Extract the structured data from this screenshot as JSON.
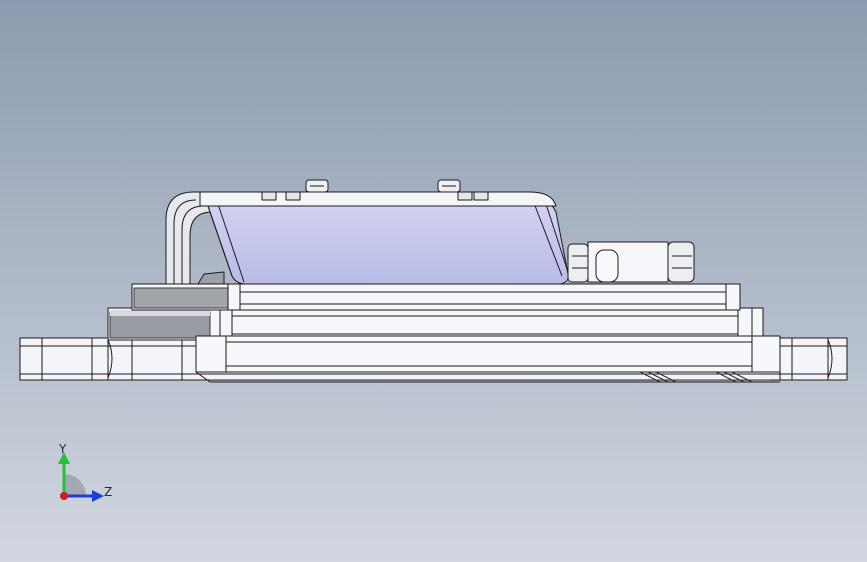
{
  "viewport": {
    "background_top": "#8c9bb0",
    "background_bottom": "#d2d7e0"
  },
  "model": {
    "outline_color": "#1a1a1a",
    "face_white": "#f6f7fa",
    "face_grey": "#c9cbd2",
    "face_dark": "#8e9098",
    "cover_lavender": "#c3c4ec",
    "cover_lavender_dark": "#9b9dd0"
  },
  "triad": {
    "y_label": "Y",
    "z_label": "Z",
    "y_color": "#22c23a",
    "z_color": "#1a3fd6",
    "origin_color": "#d61a1a",
    "arc_color": "#9aa0aa"
  }
}
